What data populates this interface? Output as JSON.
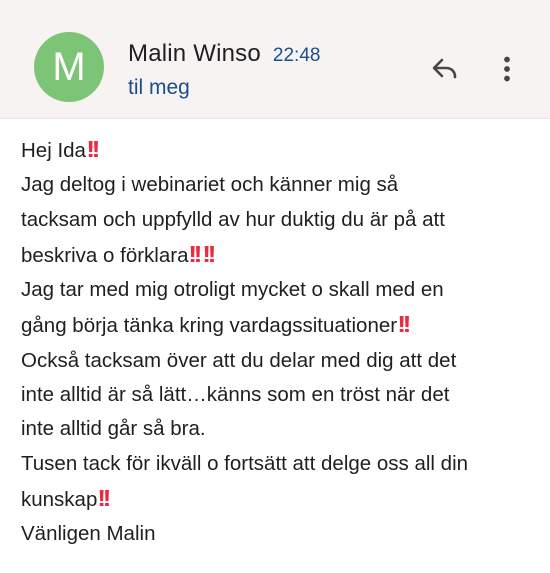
{
  "header": {
    "avatar_letter": "M",
    "avatar_color": "#7cc576",
    "sender_name": "Malin Winso",
    "time": "22:48",
    "recipient": "til meg",
    "reply_icon": "reply-arrow-icon",
    "more_icon": "more-vertical-icon"
  },
  "message": {
    "emoji": "‼️",
    "emoji_color": "#ea2a3e",
    "lines": [
      {
        "text": "Hej Ida",
        "emoji_count": 1
      },
      {
        "text": "Jag deltog i webinariet och känner mig så",
        "emoji_count": 0
      },
      {
        "text": "tacksam och uppfylld av hur duktig du är på att",
        "emoji_count": 0
      },
      {
        "text": "beskriva o förklara",
        "emoji_count": 2
      },
      {
        "text": "Jag tar med mig otroligt mycket o skall med en",
        "emoji_count": 0
      },
      {
        "text": "gång börja tänka kring vardagssituationer",
        "emoji_count": 1
      },
      {
        "text": "Också tacksam över att du delar med dig att det",
        "emoji_count": 0
      },
      {
        "text": "inte alltid är så lätt…känns som en tröst när det",
        "emoji_count": 0
      },
      {
        "text": "inte alltid går så bra.",
        "emoji_count": 0
      },
      {
        "text": "Tusen tack för ikväll o fortsätt att delge oss all din",
        "emoji_count": 0
      },
      {
        "text": "kunskap",
        "emoji_count": 1
      },
      {
        "text": "Vänligen Malin",
        "emoji_count": 0
      }
    ]
  }
}
